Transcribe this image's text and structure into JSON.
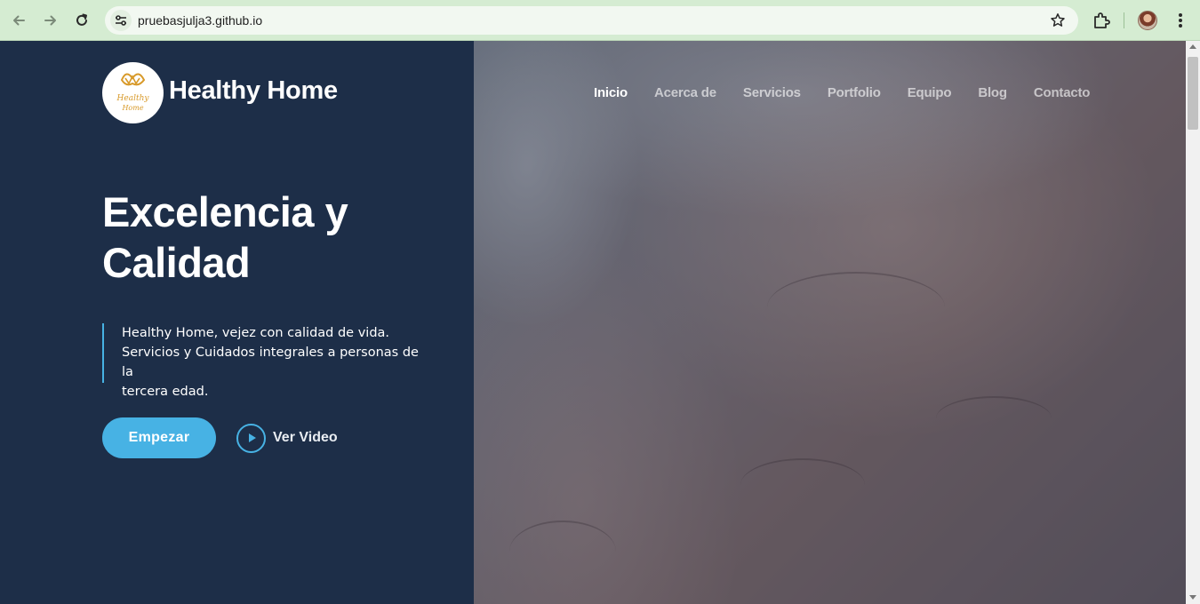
{
  "browser": {
    "url": "pruebasjulja3.github.io",
    "back_icon": "arrow-left-icon",
    "forward_icon": "arrow-right-icon",
    "reload_icon": "reload-icon",
    "site_info_icon": "tune-icon",
    "bookmark_icon": "star-icon",
    "extensions_icon": "puzzle-icon",
    "menu_icon": "kebab-menu-icon"
  },
  "header": {
    "brand": "Healthy Home",
    "logo_text": [
      "Healthy",
      "Home"
    ],
    "nav": [
      {
        "label": "Inicio",
        "active": true
      },
      {
        "label": "Acerca de",
        "active": false
      },
      {
        "label": "Servicios",
        "active": false
      },
      {
        "label": "Portfolio",
        "active": false
      },
      {
        "label": "Equipo",
        "active": false
      },
      {
        "label": "Blog",
        "active": false
      },
      {
        "label": "Contacto",
        "active": false
      }
    ]
  },
  "hero": {
    "title_line1": "Excelencia y",
    "title_line2": "Calidad",
    "description_line1": "Healthy Home, vejez con calidad de vida.",
    "description_line2": "Servicios y Cuidados integrales a personas de la",
    "description_line3": "tercera edad.",
    "cta_label": "Empezar",
    "video_label": "Ver Video"
  },
  "colors": {
    "panel": "#1d2e48",
    "accent": "#47b2e4",
    "chrome": "#d5ecd2",
    "logo_gold": "#d89a2a"
  }
}
